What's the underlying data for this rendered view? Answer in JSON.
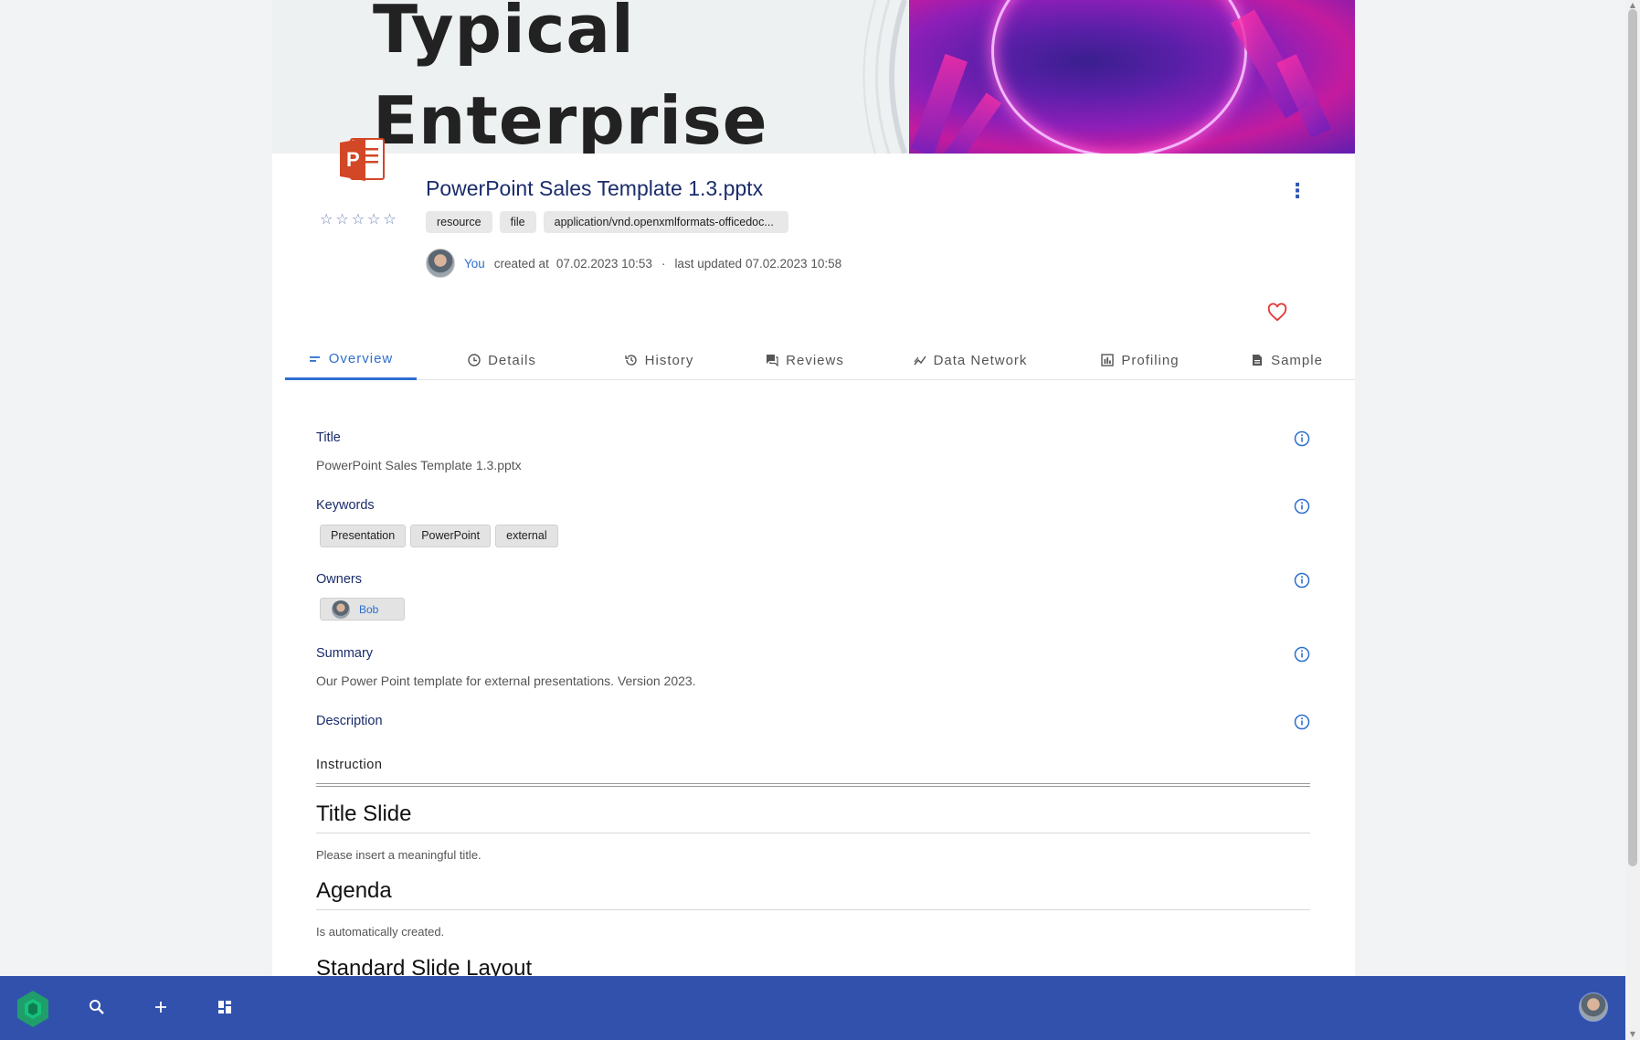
{
  "banner": {
    "title_line1": "Typical",
    "title_line2": "Enterprise"
  },
  "header": {
    "file_title": "PowerPoint Sales Template 1.3.pptx",
    "rating_stars": "☆☆☆☆☆",
    "rating": 0,
    "rating_max": 5,
    "tags": [
      "resource",
      "file",
      "application/vnd.openxmlformats-officedoc..."
    ],
    "creator": "You",
    "created_label": "created at",
    "created_at": "07.02.2023 10:53",
    "separator": "·",
    "updated_label": "last updated",
    "updated_at": "07.02.2023 10:58"
  },
  "tabs": [
    {
      "label": "Overview",
      "icon": "overview-icon",
      "active": true
    },
    {
      "label": "Details",
      "icon": "details-icon",
      "active": false
    },
    {
      "label": "History",
      "icon": "history-icon",
      "active": false
    },
    {
      "label": "Reviews",
      "icon": "reviews-icon",
      "active": false
    },
    {
      "label": "Data Network",
      "icon": "data-network-icon",
      "active": false
    },
    {
      "label": "Profiling",
      "icon": "profiling-icon",
      "active": false
    },
    {
      "label": "Sample",
      "icon": "sample-icon",
      "active": false
    }
  ],
  "fields": {
    "title_label": "Title",
    "title_value": "PowerPoint Sales Template 1.3.pptx",
    "keywords_label": "Keywords",
    "keywords": [
      "Presentation",
      "PowerPoint",
      "external"
    ],
    "owners_label": "Owners",
    "owner_name": "Bob",
    "summary_label": "Summary",
    "summary_value": "Our Power Point template for external presentations. Version 2023.",
    "description_label": "Description"
  },
  "description": {
    "subtitle": "Instruction",
    "sections": [
      {
        "heading": "Title Slide",
        "text": "Please insert a meaningful title."
      },
      {
        "heading": "Agenda",
        "text": "Is automatically created."
      },
      {
        "heading": "Standard Slide Layout",
        "text": ""
      }
    ]
  },
  "colors": {
    "accent": "#2d6fcf",
    "navy": "#1a2c6b",
    "bottombar": "#3151ad",
    "heart": "#e53935"
  }
}
